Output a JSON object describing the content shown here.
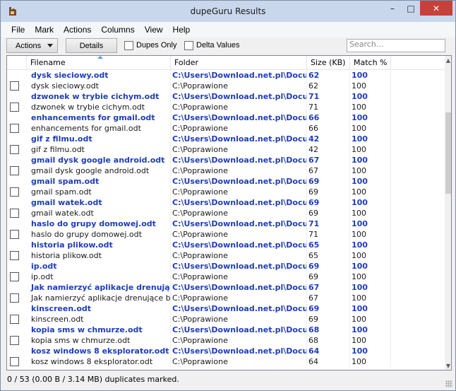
{
  "window": {
    "title": "dupeGuru Results",
    "min_glyph": "–",
    "max_glyph": "□",
    "close_glyph": "✕"
  },
  "menu": [
    "File",
    "Mark",
    "Actions",
    "Columns",
    "View",
    "Help"
  ],
  "toolbar": {
    "actions_label": "Actions",
    "details_label": "Details",
    "dupes_only_label": "Dupes Only",
    "delta_values_label": "Delta Values",
    "search_placeholder": "Search..."
  },
  "columns": {
    "filename": "Filename",
    "folder": "Folder",
    "size": "Size (KB)",
    "match": "Match %"
  },
  "rows": [
    {
      "type": "ref",
      "file": "dysk sieciowy.odt",
      "folder": "C:\\Users\\Download.net.pl\\Docum...",
      "size": "62",
      "match": "100"
    },
    {
      "type": "dup",
      "file": "dysk sieciowy.odt",
      "folder": "C:\\Poprawione",
      "size": "62",
      "match": "100"
    },
    {
      "type": "ref",
      "file": "dzwonek w trybie cichym.odt",
      "folder": "C:\\Users\\Download.net.pl\\Docum...",
      "size": "71",
      "match": "100"
    },
    {
      "type": "dup",
      "file": "dzwonek w trybie cichym.odt",
      "folder": "C:\\Poprawione",
      "size": "71",
      "match": "100"
    },
    {
      "type": "ref",
      "file": "enhancements for gmail.odt",
      "folder": "C:\\Users\\Download.net.pl\\Docum...",
      "size": "66",
      "match": "100"
    },
    {
      "type": "dup",
      "file": "enhancements for gmail.odt",
      "folder": "C:\\Poprawione",
      "size": "66",
      "match": "100"
    },
    {
      "type": "ref",
      "file": "gif z filmu.odt",
      "folder": "C:\\Users\\Download.net.pl\\Docum...",
      "size": "42",
      "match": "100"
    },
    {
      "type": "dup",
      "file": "gif z filmu.odt",
      "folder": "C:\\Poprawione",
      "size": "42",
      "match": "100"
    },
    {
      "type": "ref",
      "file": "gmail dysk google android.odt",
      "folder": "C:\\Users\\Download.net.pl\\Docum...",
      "size": "67",
      "match": "100"
    },
    {
      "type": "dup",
      "file": "gmail dysk google android.odt",
      "folder": "C:\\Poprawione",
      "size": "67",
      "match": "100"
    },
    {
      "type": "ref",
      "file": "gmail spam.odt",
      "folder": "C:\\Users\\Download.net.pl\\Docum...",
      "size": "69",
      "match": "100"
    },
    {
      "type": "dup",
      "file": "gmail spam.odt",
      "folder": "C:\\Poprawione",
      "size": "69",
      "match": "100"
    },
    {
      "type": "ref",
      "file": "gmail watek.odt",
      "folder": "C:\\Users\\Download.net.pl\\Docum...",
      "size": "69",
      "match": "100"
    },
    {
      "type": "dup",
      "file": "gmail watek.odt",
      "folder": "C:\\Poprawione",
      "size": "69",
      "match": "100"
    },
    {
      "type": "ref",
      "file": "haslo do grupy domowej.odt",
      "folder": "C:\\Users\\Download.net.pl\\Docum...",
      "size": "71",
      "match": "100"
    },
    {
      "type": "dup",
      "file": "haslo do grupy domowej.odt",
      "folder": "C:\\Poprawione",
      "size": "71",
      "match": "100"
    },
    {
      "type": "ref",
      "file": "historia plikow.odt",
      "folder": "C:\\Users\\Download.net.pl\\Docum...",
      "size": "65",
      "match": "100"
    },
    {
      "type": "dup",
      "file": "historia plikow.odt",
      "folder": "C:\\Poprawione",
      "size": "65",
      "match": "100"
    },
    {
      "type": "ref",
      "file": "ip.odt",
      "folder": "C:\\Users\\Download.net.pl\\Docum...",
      "size": "69",
      "match": "100"
    },
    {
      "type": "dup",
      "file": "ip.odt",
      "folder": "C:\\Poprawione",
      "size": "69",
      "match": "100"
    },
    {
      "type": "ref",
      "file": "Jak namierzyć aplikacje drenujące ...",
      "folder": "C:\\Users\\Download.net.pl\\Docum...",
      "size": "67",
      "match": "100"
    },
    {
      "type": "dup",
      "file": "Jak namierzyć aplikacje drenujące b...",
      "folder": "C:\\Poprawione",
      "size": "67",
      "match": "100"
    },
    {
      "type": "ref",
      "file": "kinscreen.odt",
      "folder": "C:\\Users\\Download.net.pl\\Docum...",
      "size": "69",
      "match": "100"
    },
    {
      "type": "dup",
      "file": "kinscreen.odt",
      "folder": "C:\\Poprawione",
      "size": "69",
      "match": "100"
    },
    {
      "type": "ref",
      "file": "kopia sms w chmurze.odt",
      "folder": "C:\\Users\\Download.net.pl\\Docum...",
      "size": "68",
      "match": "100"
    },
    {
      "type": "dup",
      "file": "kopia sms w chmurze.odt",
      "folder": "C:\\Poprawione",
      "size": "68",
      "match": "100"
    },
    {
      "type": "ref",
      "file": "kosz windows 8 eksplorator.odt",
      "folder": "C:\\Users\\Download.net.pl\\Docum...",
      "size": "64",
      "match": "100"
    },
    {
      "type": "dup",
      "file": "kosz windows 8 eksplorator.odt",
      "folder": "C:\\Poprawione",
      "size": "64",
      "match": "100"
    }
  ],
  "status": "0 / 53 (0.00 B / 3.14 MB) duplicates marked."
}
